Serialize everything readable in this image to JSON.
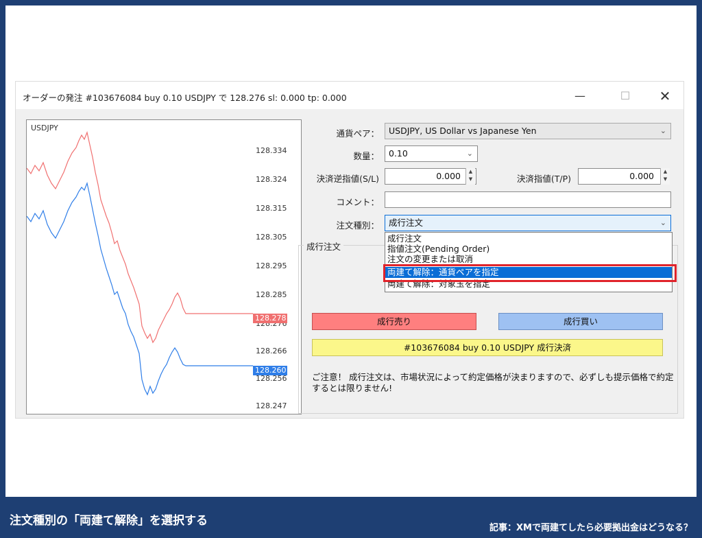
{
  "window": {
    "title": "オーダーの発注 #103676084 buy 0.10 USDJPY で 128.276 sl: 0.000 tp: 0.000",
    "min_glyph": "—",
    "max_glyph": "☐",
    "close_glyph": "✕"
  },
  "chart": {
    "symbol": "USDJPY",
    "yticks": [
      "128.334",
      "128.324",
      "128.315",
      "128.305",
      "128.295",
      "128.285",
      "128.276",
      "128.266",
      "128.256",
      "128.247"
    ],
    "ask_tag": "128.278",
    "bid_tag": "128.260",
    "ask_color": "#f07070",
    "bid_color": "#2f7ee8"
  },
  "form": {
    "symbol_label": "通貨ペア：",
    "symbol_value": "USDJPY, US Dollar vs Japanese Yen",
    "volume_label": "数量：",
    "volume_value": "0.10",
    "sl_label": "決済逆指値(S/L)",
    "sl_value": "0.000",
    "tp_label": "決済指値(T/P)",
    "tp_value": "0.000",
    "comment_label": "コメント：",
    "comment_value": "",
    "type_label": "注文種別：",
    "type_value": "成行注文"
  },
  "dropdown": {
    "items": [
      "成行注文",
      "指値注文(Pending Order)",
      "注文の変更または取消",
      "両建て解除：通貨ペアを指定",
      "両建て解除：対象玉を指定"
    ],
    "selected_index": 3
  },
  "group": {
    "label": "成行注文"
  },
  "buttons": {
    "sell": "成行売り",
    "buy": "成行買い",
    "close": "#103676084 buy 0.10 USDJPY 成行決済"
  },
  "notice": "ご注意！ 成行注文は、市場状況によって約定価格が決まりますので、必ずしも提示価格で約定するとは限りません!",
  "caption": {
    "main": "注文種別の「両建て解除」を選択する",
    "sub": "記事：XMで両建てしたら必要拠出金はどうなる？"
  }
}
